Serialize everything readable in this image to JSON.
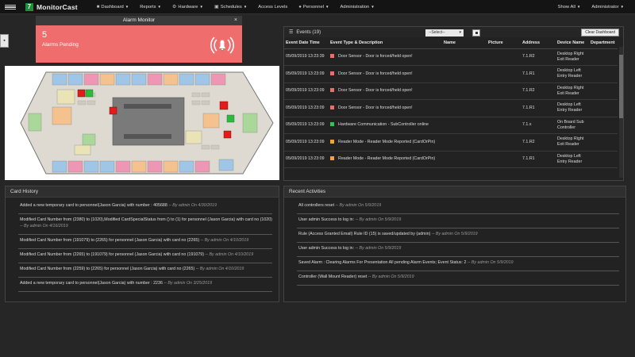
{
  "app": {
    "name": "MonitorCast",
    "logo_glyph": "7"
  },
  "nav": {
    "items": [
      {
        "label": "Dashboard",
        "icon": "dashboard-icon",
        "glyph": "■"
      },
      {
        "label": "Reports",
        "icon": "",
        "glyph": ""
      },
      {
        "label": "Hardware",
        "icon": "gear-icon",
        "glyph": "⚙"
      },
      {
        "label": "Schedules",
        "icon": "calendar-icon",
        "glyph": "▣"
      },
      {
        "label": "Access Levels",
        "icon": "",
        "glyph": ""
      },
      {
        "label": "Personnel",
        "icon": "user-icon",
        "glyph": "●"
      },
      {
        "label": "Administration",
        "icon": "",
        "glyph": ""
      }
    ],
    "right": [
      {
        "label": "Show All"
      },
      {
        "label": "Administrator"
      }
    ]
  },
  "alarm": {
    "title": "Alarm Monitor",
    "close": "×",
    "count": "5",
    "label": "Alarms Pending",
    "bg_color": "#ef6d6d"
  },
  "events": {
    "title": "Events (19)",
    "select_value": "--Select--",
    "clear_label": "Clear Dashboard",
    "columns": [
      "Event Date Time",
      "Event Type & Description",
      "Name",
      "Picture",
      "Address",
      "Device Name",
      "Department"
    ],
    "rows": [
      {
        "dt": "05/09/2019 13:23:39",
        "color": "#e8706a",
        "desc": "Door Sensor - Door is forced/held open!",
        "name": "",
        "address": "7.1.R2",
        "device": "Desktop Right Exit Reader",
        "dept": ""
      },
      {
        "dt": "05/09/2019 13:23:09",
        "color": "#e8706a",
        "desc": "Door Sensor - Door is forced/held open!",
        "name": "",
        "address": "7.1.R1",
        "device": "Desktop Left Entry Reader",
        "dept": ""
      },
      {
        "dt": "05/09/2019 13:23:09",
        "color": "#e8706a",
        "desc": "Door Sensor - Door is forced/held open!",
        "name": "",
        "address": "7.1.R2",
        "device": "Desktop Right Exit Reader",
        "dept": ""
      },
      {
        "dt": "05/09/2019 13:23:09",
        "color": "#e8706a",
        "desc": "Door Sensor - Door is forced/held open!",
        "name": "",
        "address": "7.1.R1",
        "device": "Desktop Left Entry Reader",
        "dept": ""
      },
      {
        "dt": "05/09/2019 13:23:09",
        "color": "#3cbf55",
        "desc": "Hardware Communication - SubController online",
        "name": "",
        "address": "7.1.x",
        "device": "On Board Sub Controller",
        "dept": ""
      },
      {
        "dt": "05/09/2019 13:23:09",
        "color": "#f0a33c",
        "desc": "Reader Mode - Reader Mode Reported (CardOrPin)",
        "name": "",
        "address": "7.1.R2",
        "device": "Desktop Right Exit Reader",
        "dept": ""
      },
      {
        "dt": "05/09/2019 13:23:09",
        "color": "#f0a33c",
        "desc": "Reader Mode - Reader Mode Reported (CardOrPin)",
        "name": "",
        "address": "7.1.R1",
        "device": "Desktop Left Entry Reader",
        "dept": ""
      }
    ]
  },
  "card_history": {
    "title": "Card History",
    "items": [
      {
        "text": "Added a new temporary card to personnel(Jason Garcia) with number : 405688",
        "meta": "-- By admin On 4/30/2019"
      },
      {
        "text": "Modified Card Number from (2380) to (1020),Modified CardSpecialStatus from () to (1) for personnel (Jason Garcia) with card no (1020)",
        "meta": "-- By admin On 4/16/2019"
      },
      {
        "text": "Modified Card Number from (191079) to (2265) for personnel (Jason Garcia) with card no (2265)",
        "meta": "-- By admin On 4/10/2019"
      },
      {
        "text": "Modified Card Number from (2265) to (191079) for personnel (Jason Garcia) with card no (191079)",
        "meta": "-- By admin On 4/10/2019"
      },
      {
        "text": "Modified Card Number from (2259) to (2265) for personnel (Jason Garcia) with card no (2265)",
        "meta": "-- By admin On 4/10/2019"
      },
      {
        "text": "Added a new temporary card to personnel(Jason Garcia) with number : 2236",
        "meta": "-- By admin On 3/25/2019"
      }
    ]
  },
  "recent": {
    "title": "Recent Activities",
    "items": [
      {
        "text": "All controllers reset",
        "meta": "-- By admin On 5/9/2019"
      },
      {
        "text": "User admin Success to log in:",
        "meta": "-- By admin On 5/9/2019"
      },
      {
        "text": "Rule (Access Granted Email) Rule ID (15) is saved/updated by (admin)",
        "meta": "-- By admin On 5/9/2019"
      },
      {
        "text": "User admin Success to log in:",
        "meta": "-- By admin On 5/9/2019"
      },
      {
        "text": "Saved Alarm : Clearing Alarms For Presentation All pending Alarm Events; Event Status: 2",
        "meta": "-- By admin On 5/9/2019"
      },
      {
        "text": "Controller (Wall Mount Reader) reset",
        "meta": "-- By admin On 5/9/2019"
      }
    ]
  }
}
